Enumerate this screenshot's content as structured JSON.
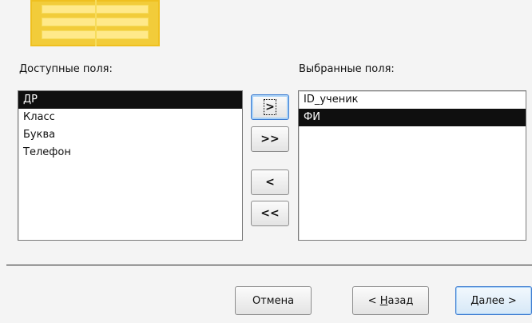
{
  "labels": {
    "available": "Доступные поля:",
    "selected": "Выбранные поля:"
  },
  "available_fields": [
    {
      "label": "ДР",
      "selected": true
    },
    {
      "label": "Класс",
      "selected": false
    },
    {
      "label": "Буква",
      "selected": false
    },
    {
      "label": "Телефон",
      "selected": false
    }
  ],
  "selected_fields": [
    {
      "label": "ID_ученик",
      "selected": false
    },
    {
      "label": "ФИ",
      "selected": true
    }
  ],
  "move_buttons": {
    "add_one": ">",
    "add_all": ">>",
    "remove_one": "<",
    "remove_all": "<<"
  },
  "footer": {
    "cancel": "Отмена",
    "back_prefix": "< ",
    "back_hotkey": "Н",
    "back_rest": "азад",
    "next_hotkey": "Д",
    "next_rest": "алее >"
  },
  "colors": {
    "wizard_graphic": "#f2cc3a",
    "selection": "#0f0f0f",
    "focus_border": "#3d7bd0"
  }
}
